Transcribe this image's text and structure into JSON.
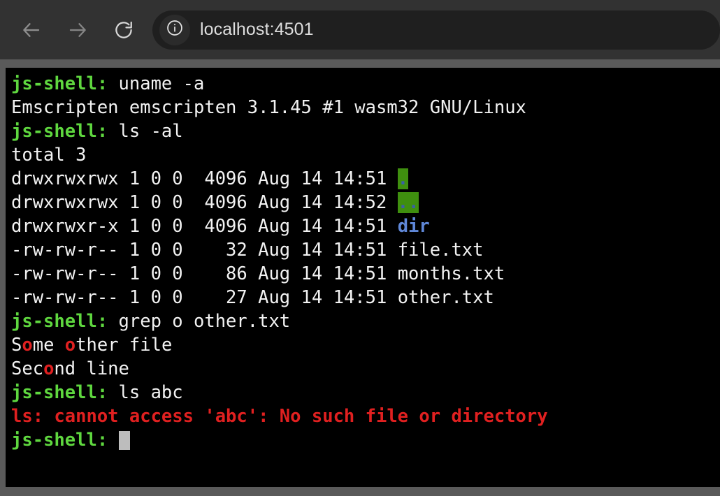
{
  "browser": {
    "back_icon": "arrow-left-icon",
    "forward_icon": "arrow-right-icon",
    "reload_icon": "reload-icon",
    "site_info_icon": "info-circle-icon",
    "url": "localhost:4501"
  },
  "terminal": {
    "prompt": "js-shell:",
    "cursor": "block-cursor",
    "lines": [
      {
        "type": "prompt",
        "command": " uname -a"
      },
      {
        "type": "output",
        "text": "Emscripten emscripten 3.1.45 #1 wasm32 GNU/Linux"
      },
      {
        "type": "prompt",
        "command": " ls -al"
      },
      {
        "type": "output",
        "text": "total 3"
      },
      {
        "type": "listing",
        "perms": "drwxrwxrwx",
        "links": "1",
        "owner": "0",
        "group": "0",
        "size": "4096",
        "month": "Aug",
        "day": "14",
        "time": "14:51",
        "name": ".",
        "style": "dir-highlight"
      },
      {
        "type": "listing",
        "perms": "drwxrwxrwx",
        "links": "1",
        "owner": "0",
        "group": "0",
        "size": "4096",
        "month": "Aug",
        "day": "14",
        "time": "14:52",
        "name": "..",
        "style": "dir-highlight"
      },
      {
        "type": "listing",
        "perms": "drwxrwxr-x",
        "links": "1",
        "owner": "0",
        "group": "0",
        "size": "4096",
        "month": "Aug",
        "day": "14",
        "time": "14:51",
        "name": "dir",
        "style": "dir-blue"
      },
      {
        "type": "listing",
        "perms": "-rw-rw-r--",
        "links": "1",
        "owner": "0",
        "group": "0",
        "size": "32",
        "month": "Aug",
        "day": "14",
        "time": "14:51",
        "name": "file.txt",
        "style": "file"
      },
      {
        "type": "listing",
        "perms": "-rw-rw-r--",
        "links": "1",
        "owner": "0",
        "group": "0",
        "size": "86",
        "month": "Aug",
        "day": "14",
        "time": "14:51",
        "name": "months.txt",
        "style": "file"
      },
      {
        "type": "listing",
        "perms": "-rw-rw-r--",
        "links": "1",
        "owner": "0",
        "group": "0",
        "size": "27",
        "month": "Aug",
        "day": "14",
        "time": "14:51",
        "name": "other.txt",
        "style": "file"
      },
      {
        "type": "prompt",
        "command": " grep o other.txt"
      },
      {
        "type": "match",
        "segments": [
          {
            "t": "S",
            "hl": false
          },
          {
            "t": "o",
            "hl": true
          },
          {
            "t": "me ",
            "hl": false
          },
          {
            "t": "o",
            "hl": true
          },
          {
            "t": "ther file",
            "hl": false
          }
        ]
      },
      {
        "type": "match",
        "segments": [
          {
            "t": "Sec",
            "hl": false
          },
          {
            "t": "o",
            "hl": true
          },
          {
            "t": "nd line",
            "hl": false
          }
        ]
      },
      {
        "type": "prompt",
        "command": " ls abc"
      },
      {
        "type": "error",
        "text": "ls: cannot access 'abc': No such file or directory"
      },
      {
        "type": "prompt_cursor",
        "command": " "
      }
    ]
  }
}
